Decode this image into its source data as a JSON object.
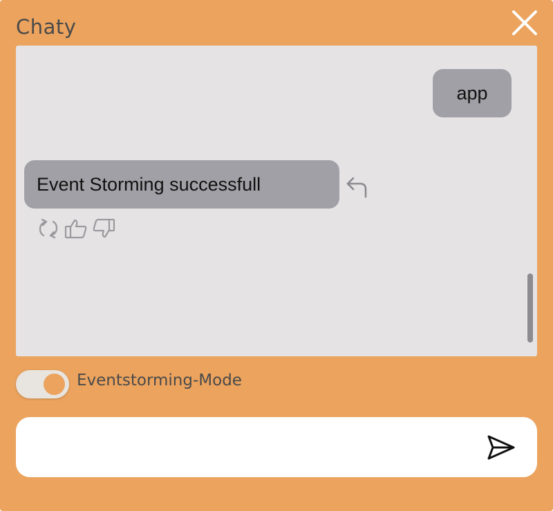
{
  "window": {
    "title": "Chaty",
    "accent_color": "#eba35e",
    "close_icon": "close-icon"
  },
  "messages": [
    {
      "role": "user",
      "text": "app"
    },
    {
      "role": "bot",
      "text": "Event Storming successfull"
    }
  ],
  "message_actions": {
    "reply_icon": "reply-arrow-icon",
    "icons": [
      "regenerate-icon",
      "thumbs-up-icon",
      "thumbs-down-icon"
    ]
  },
  "mode_toggle": {
    "label": "Eventstorming-Mode",
    "enabled": true
  },
  "composer": {
    "value": "",
    "placeholder": "",
    "send_icon": "send-icon"
  }
}
